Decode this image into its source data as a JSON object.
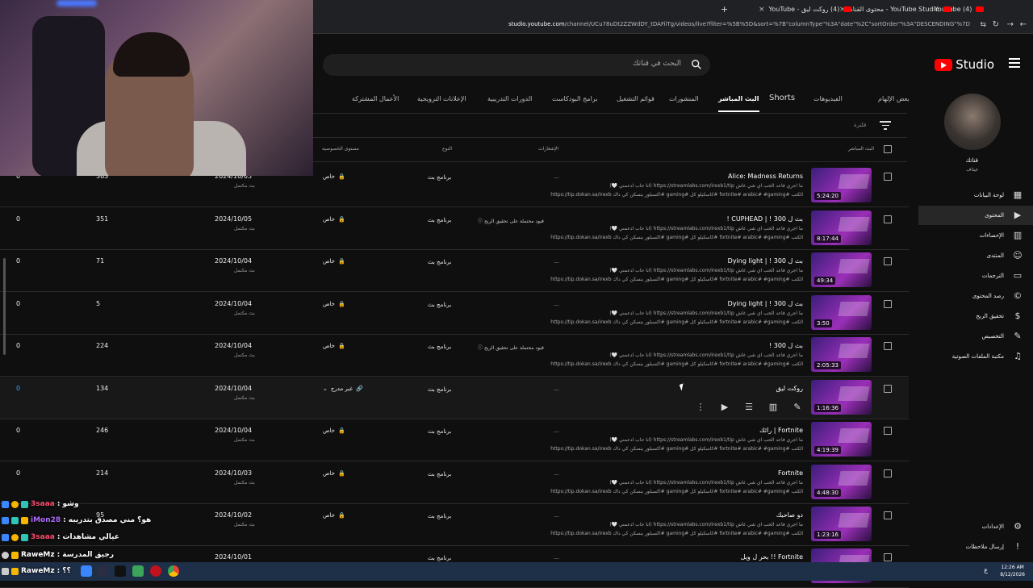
{
  "browser": {
    "tabs": [
      {
        "label": "(4) YouTube"
      },
      {
        "label": "YouTube Studio - محتوى القناة"
      },
      {
        "label": "(4) روكت ليق - YouTube"
      }
    ],
    "url_host": "studio.youtube.com",
    "url_path": "/channel/UCu78uDt2ZZWdDY_tDAFiiTg/videos/live?filter=%5B%5D&sort=%7B\"columnType\"%3A\"date\"%2C\"sortOrder\"%3A\"DESCENDING\"%7D"
  },
  "header": {
    "logo_text": "Studio",
    "search_placeholder": "البحث في قناتك"
  },
  "channel": {
    "name": "قناتك",
    "handle": "غيثاف"
  },
  "sidebar": {
    "items": [
      {
        "label": "لوحة البيانات",
        "icon": "dashboard-icon"
      },
      {
        "label": "المحتوى",
        "icon": "content-icon",
        "active": true
      },
      {
        "label": "الإحصاءات",
        "icon": "analytics-icon"
      },
      {
        "label": "المنتدى",
        "icon": "community-icon"
      },
      {
        "label": "الترجمات",
        "icon": "subtitles-icon"
      },
      {
        "label": "رصد المحتوى",
        "icon": "copyright-icon"
      },
      {
        "label": "تحقيق الربح",
        "icon": "earn-icon"
      },
      {
        "label": "التخصيص",
        "icon": "customization-icon"
      },
      {
        "label": "مكتبة الملفات الصوتية",
        "icon": "audio-library-icon"
      }
    ],
    "bottom": [
      {
        "label": "الإعدادات",
        "icon": "settings-icon"
      },
      {
        "label": "إرسال ملاحظات",
        "icon": "feedback-icon"
      }
    ]
  },
  "content_tabs": [
    {
      "label": "بعض الإلهام"
    },
    {
      "label": "الفيديوهات"
    },
    {
      "label": "Shorts"
    },
    {
      "label": "البث المباشر",
      "active": true
    },
    {
      "label": "المنشورات"
    },
    {
      "label": "قوائم التشغيل"
    },
    {
      "label": "برامج البودكاست"
    },
    {
      "label": "الدورات التدريبية"
    },
    {
      "label": "الإعلانات الترويجية"
    },
    {
      "label": "الأعمال المشتركة"
    }
  ],
  "filter_label": "فلترة",
  "columns": {
    "live": "البث المباشر",
    "restrictions": "الإشعارات",
    "type": "النوع",
    "visibility": "مستوى الخصوصية"
  },
  "desc_line1": "ما اجري فاعد الحب اي شي غاش https://streamlabs.com/irexb1/tip (انا حاب ادعمني 🤍)",
  "desc_line2": "الكتب #fortnite# arabic# #gaming #كاسكيلو كل #gaming #اكسبلور ينسكن كي داك https://tip.dokan.sa/irexb",
  "rows": [
    {
      "title": "Alice: Madness Returns",
      "duration": "5:24:20",
      "restriction": "",
      "type": "برنامج بث",
      "visibility": "خاص",
      "date": "2024/10/05",
      "date_sub": "بث مكتمل",
      "views": "363",
      "comments": "0"
    },
    {
      "title": "بث ل 300 ! | CUPHEAD !",
      "duration": "8:17:44",
      "restriction": "قيود محتملة على تحقيق الربح",
      "type": "برنامج بث",
      "visibility": "خاص",
      "date": "2024/10/05",
      "date_sub": "بث مكتمل",
      "views": "351",
      "comments": "0"
    },
    {
      "title": "بث ل 300 ! | Dying light",
      "duration": "49:34",
      "restriction": "",
      "type": "برنامج بث",
      "visibility": "خاص",
      "date": "2024/10/04",
      "date_sub": "بث مكتمل",
      "views": "71",
      "comments": "0"
    },
    {
      "title": "بث ل 300 ! | Dying light",
      "duration": "3:50",
      "restriction": "",
      "type": "برنامج بث",
      "visibility": "خاص",
      "date": "2024/10/04",
      "date_sub": "بث مكتمل",
      "views": "5",
      "comments": "0"
    },
    {
      "title": "بث ل 300 !",
      "duration": "2:05:33",
      "restriction": "قيود محتملة على تحقيق الربح",
      "type": "برنامج بث",
      "visibility": "خاص",
      "date": "2024/10/04",
      "date_sub": "بث مكتمل",
      "views": "224",
      "comments": "0"
    },
    {
      "title": "روكت ليق",
      "duration": "1:16:36",
      "restriction": "",
      "type": "برنامج بث",
      "visibility": "غير مدرج",
      "date": "2024/10/04",
      "date_sub": "بث مكتمل",
      "views": "134",
      "comments": "0",
      "hover": true
    },
    {
      "title": "Fortnite | رائك",
      "duration": "4:19:39",
      "restriction": "",
      "type": "برنامج بث",
      "visibility": "خاص",
      "date": "2024/10/04",
      "date_sub": "بث مكتمل",
      "views": "246",
      "comments": "0"
    },
    {
      "title": "Fortnite",
      "duration": "4:48:30",
      "restriction": "",
      "type": "برنامج بث",
      "visibility": "خاص",
      "date": "2024/10/03",
      "date_sub": "بث مكتمل",
      "views": "214",
      "comments": "0"
    },
    {
      "title": "دو صاحبك",
      "duration": "1:23:16",
      "restriction": "",
      "type": "برنامج بث",
      "visibility": "خاص",
      "date": "2024/10/02",
      "date_sub": "بث مكتمل",
      "views": "95",
      "comments": ""
    },
    {
      "title": "Fortnite !! بحر ل ويل",
      "duration": "",
      "restriction": "",
      "type": "برنامج بث",
      "visibility": "",
      "date": "2024/10/01",
      "date_sub": "",
      "views": "",
      "comments": ""
    }
  ],
  "chat": [
    {
      "user": "3saaa",
      "text": "وشو",
      "color": "#ff4d6d"
    },
    {
      "user": "iMon28",
      "text": "هو؟ مني مصدق بتدريبه",
      "color": "#b06bff"
    },
    {
      "user": "3saaa",
      "text": "عيالي مشاهدات",
      "color": "#ff4d6d"
    },
    {
      "user": "RaweMz",
      "text": "رجيق المدرسة",
      "color": "#ffffff"
    },
    {
      "user": "RaweMz",
      "text": "؟؟",
      "color": "#ffffff"
    }
  ],
  "taskbar": {
    "time": "12:26 AM",
    "date": "8/12/2026",
    "lang": "ع"
  },
  "colors": {
    "accent": "#ff0000",
    "background": "#0f0f0f",
    "taskbar": "#1e2f48"
  }
}
